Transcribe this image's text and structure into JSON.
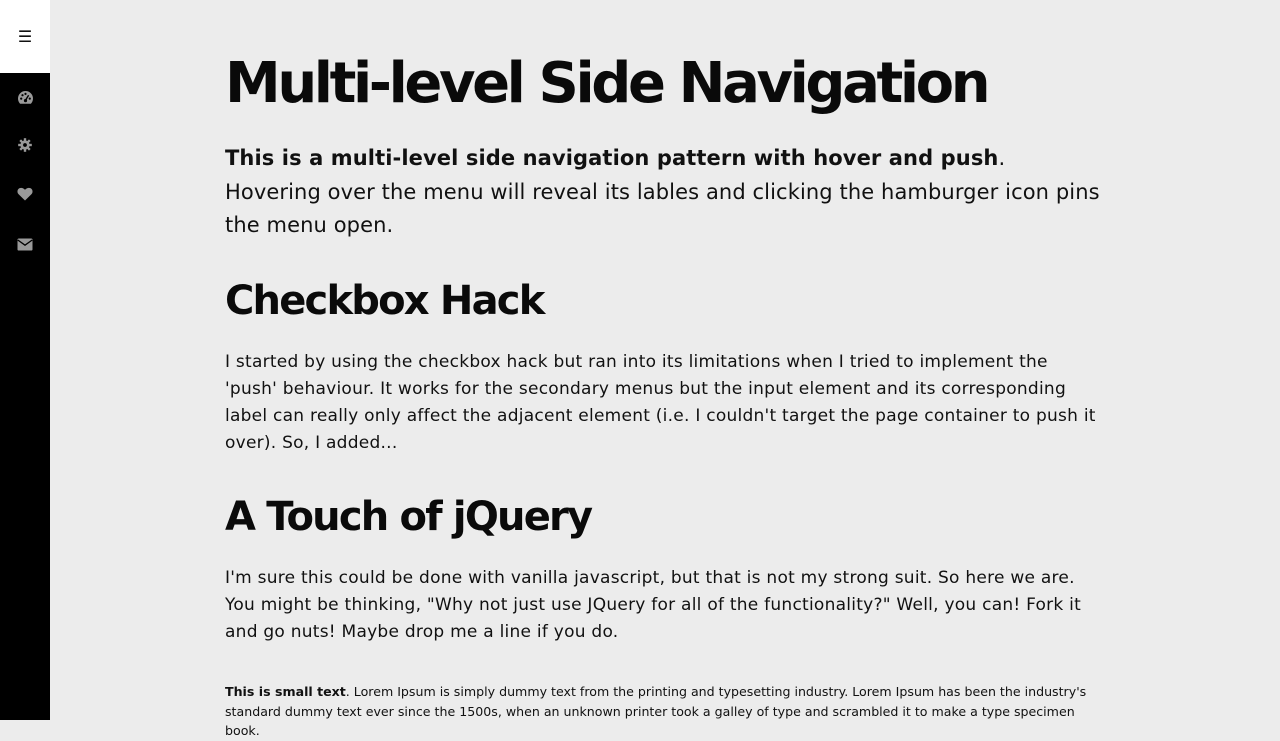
{
  "sidebar": {
    "menu_glyph": "☰",
    "items": [
      {
        "icon": "dashboard-icon"
      },
      {
        "icon": "gear-icon"
      },
      {
        "icon": "heart-icon"
      },
      {
        "icon": "envelope-icon"
      }
    ]
  },
  "main": {
    "title": "Multi-level Side Navigation",
    "lead_bold": "This is a multi-level side navigation pattern with hover and push",
    "lead_rest": ". Hovering over the menu will reveal its lables and clicking the hamburger icon pins the menu open.",
    "section1_heading": "Checkbox Hack",
    "section1_text": "I started by using the checkbox hack but ran into its limitations when I tried to implement the 'push' behaviour. It works for the secondary menus but the input element and its corresponding label can really only affect the adjacent element (i.e. I couldn't target the page container to push it over). So, I added...",
    "section2_heading": "A Touch of jQuery",
    "section2_text": "I'm sure this could be done with vanilla javascript, but that is not my strong suit. So here we are. You might be thinking, \"Why not just use JQuery for all of the functionality?\" Well, you can! Fork it and go nuts! Maybe drop me a line if you do.",
    "small_bold": "This is small text",
    "small_rest": ". Lorem Ipsum is simply dummy text from the printing and typesetting industry. Lorem Ipsum has been the industry's standard dummy text ever since the 1500s, when an unknown printer took a galley of type and scrambled it to make a type specimen book."
  },
  "colors": {
    "sidebar_bg": "#000000",
    "page_bg": "#ececec",
    "icon_color": "#9a9a9a"
  }
}
